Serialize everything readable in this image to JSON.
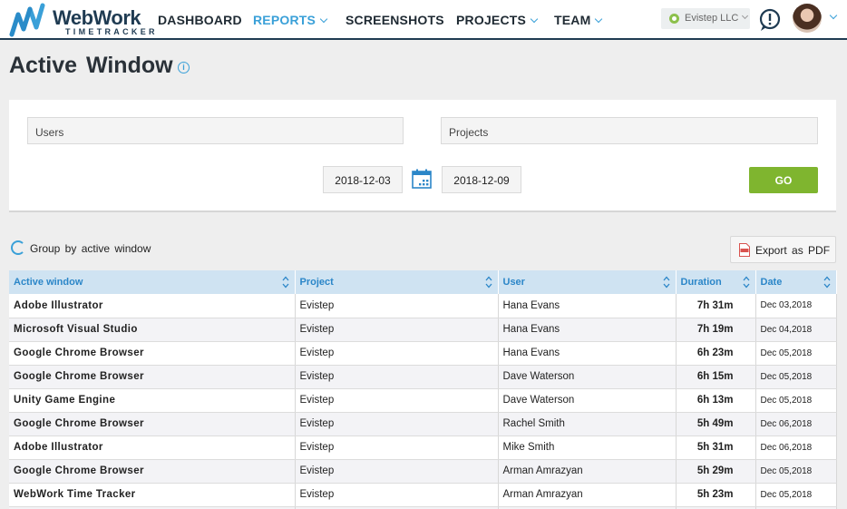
{
  "brand": {
    "name": "WebWork",
    "sub": "TIMETRACKER",
    "color": "#1f3b52",
    "accent": "#3aa0d8"
  },
  "nav": [
    {
      "label": "DASHBOARD",
      "active": false
    },
    {
      "label": "REPORTS",
      "active": true
    },
    {
      "label": "SCREENSHOTS",
      "active": false
    },
    {
      "label": "PROJECTS",
      "active": false
    },
    {
      "label": "TEAM",
      "active": false
    }
  ],
  "company": {
    "label": "Evistep LLC"
  },
  "icons": {
    "alert": "alert-bubble-icon",
    "avatar": "user-avatar",
    "info": "info-icon",
    "calendar": "calendar-icon",
    "pdf": "pdf-icon",
    "sort": "sort-icon"
  },
  "page": {
    "title": "Active  Window"
  },
  "filters": {
    "users_placeholder": "Users",
    "projects_placeholder": "Projects",
    "date_from": "2018-12-03",
    "date_to": "2018-12-09",
    "go_label": "GO",
    "go_color": "#7fb52f"
  },
  "group_label": "Group  by  active  window",
  "export_label": "Export  as  PDF",
  "table": {
    "headers": {
      "active_window": "Active  window",
      "project": "Project",
      "user": "User",
      "duration": "Duration",
      "date": "Date"
    },
    "rows": [
      {
        "active_window": "Adobe  Illustrator",
        "project": "Evistep",
        "user": "Hana  Evans",
        "duration": "7h  31m",
        "date": "Dec 03,2018"
      },
      {
        "active_window": "Microsoft  Visual  Studio",
        "project": "Evistep",
        "user": "Hana  Evans",
        "duration": "7h  19m",
        "date": "Dec 04,2018"
      },
      {
        "active_window": "Google  Chrome  Browser",
        "project": "Evistep",
        "user": "Hana  Evans",
        "duration": "6h  23m",
        "date": "Dec 05,2018"
      },
      {
        "active_window": "Google  Chrome  Browser",
        "project": "Evistep",
        "user": "Dave  Waterson",
        "duration": "6h  15m",
        "date": "Dec 05,2018"
      },
      {
        "active_window": "Unity  Game  Engine",
        "project": "Evistep",
        "user": "Dave  Waterson",
        "duration": "6h  13m",
        "date": "Dec 05,2018"
      },
      {
        "active_window": "Google  Chrome  Browser",
        "project": "Evistep",
        "user": "Rachel  Smith",
        "duration": "5h  49m",
        "date": "Dec 06,2018"
      },
      {
        "active_window": "Adobe  Illustrator",
        "project": "Evistep",
        "user": "Mike  Smith",
        "duration": "5h  31m",
        "date": "Dec 06,2018"
      },
      {
        "active_window": "Google  Chrome  Browser",
        "project": "Evistep",
        "user": "Arman  Amrazyan",
        "duration": "5h  29m",
        "date": "Dec 05,2018"
      },
      {
        "active_window": "WebWork  Time  Tracker",
        "project": "Evistep",
        "user": "Arman  Amrazyan",
        "duration": "5h  23m",
        "date": "Dec 05,2018"
      },
      {
        "active_window": "",
        "project": "",
        "user": "",
        "duration": "",
        "date": ""
      }
    ]
  }
}
